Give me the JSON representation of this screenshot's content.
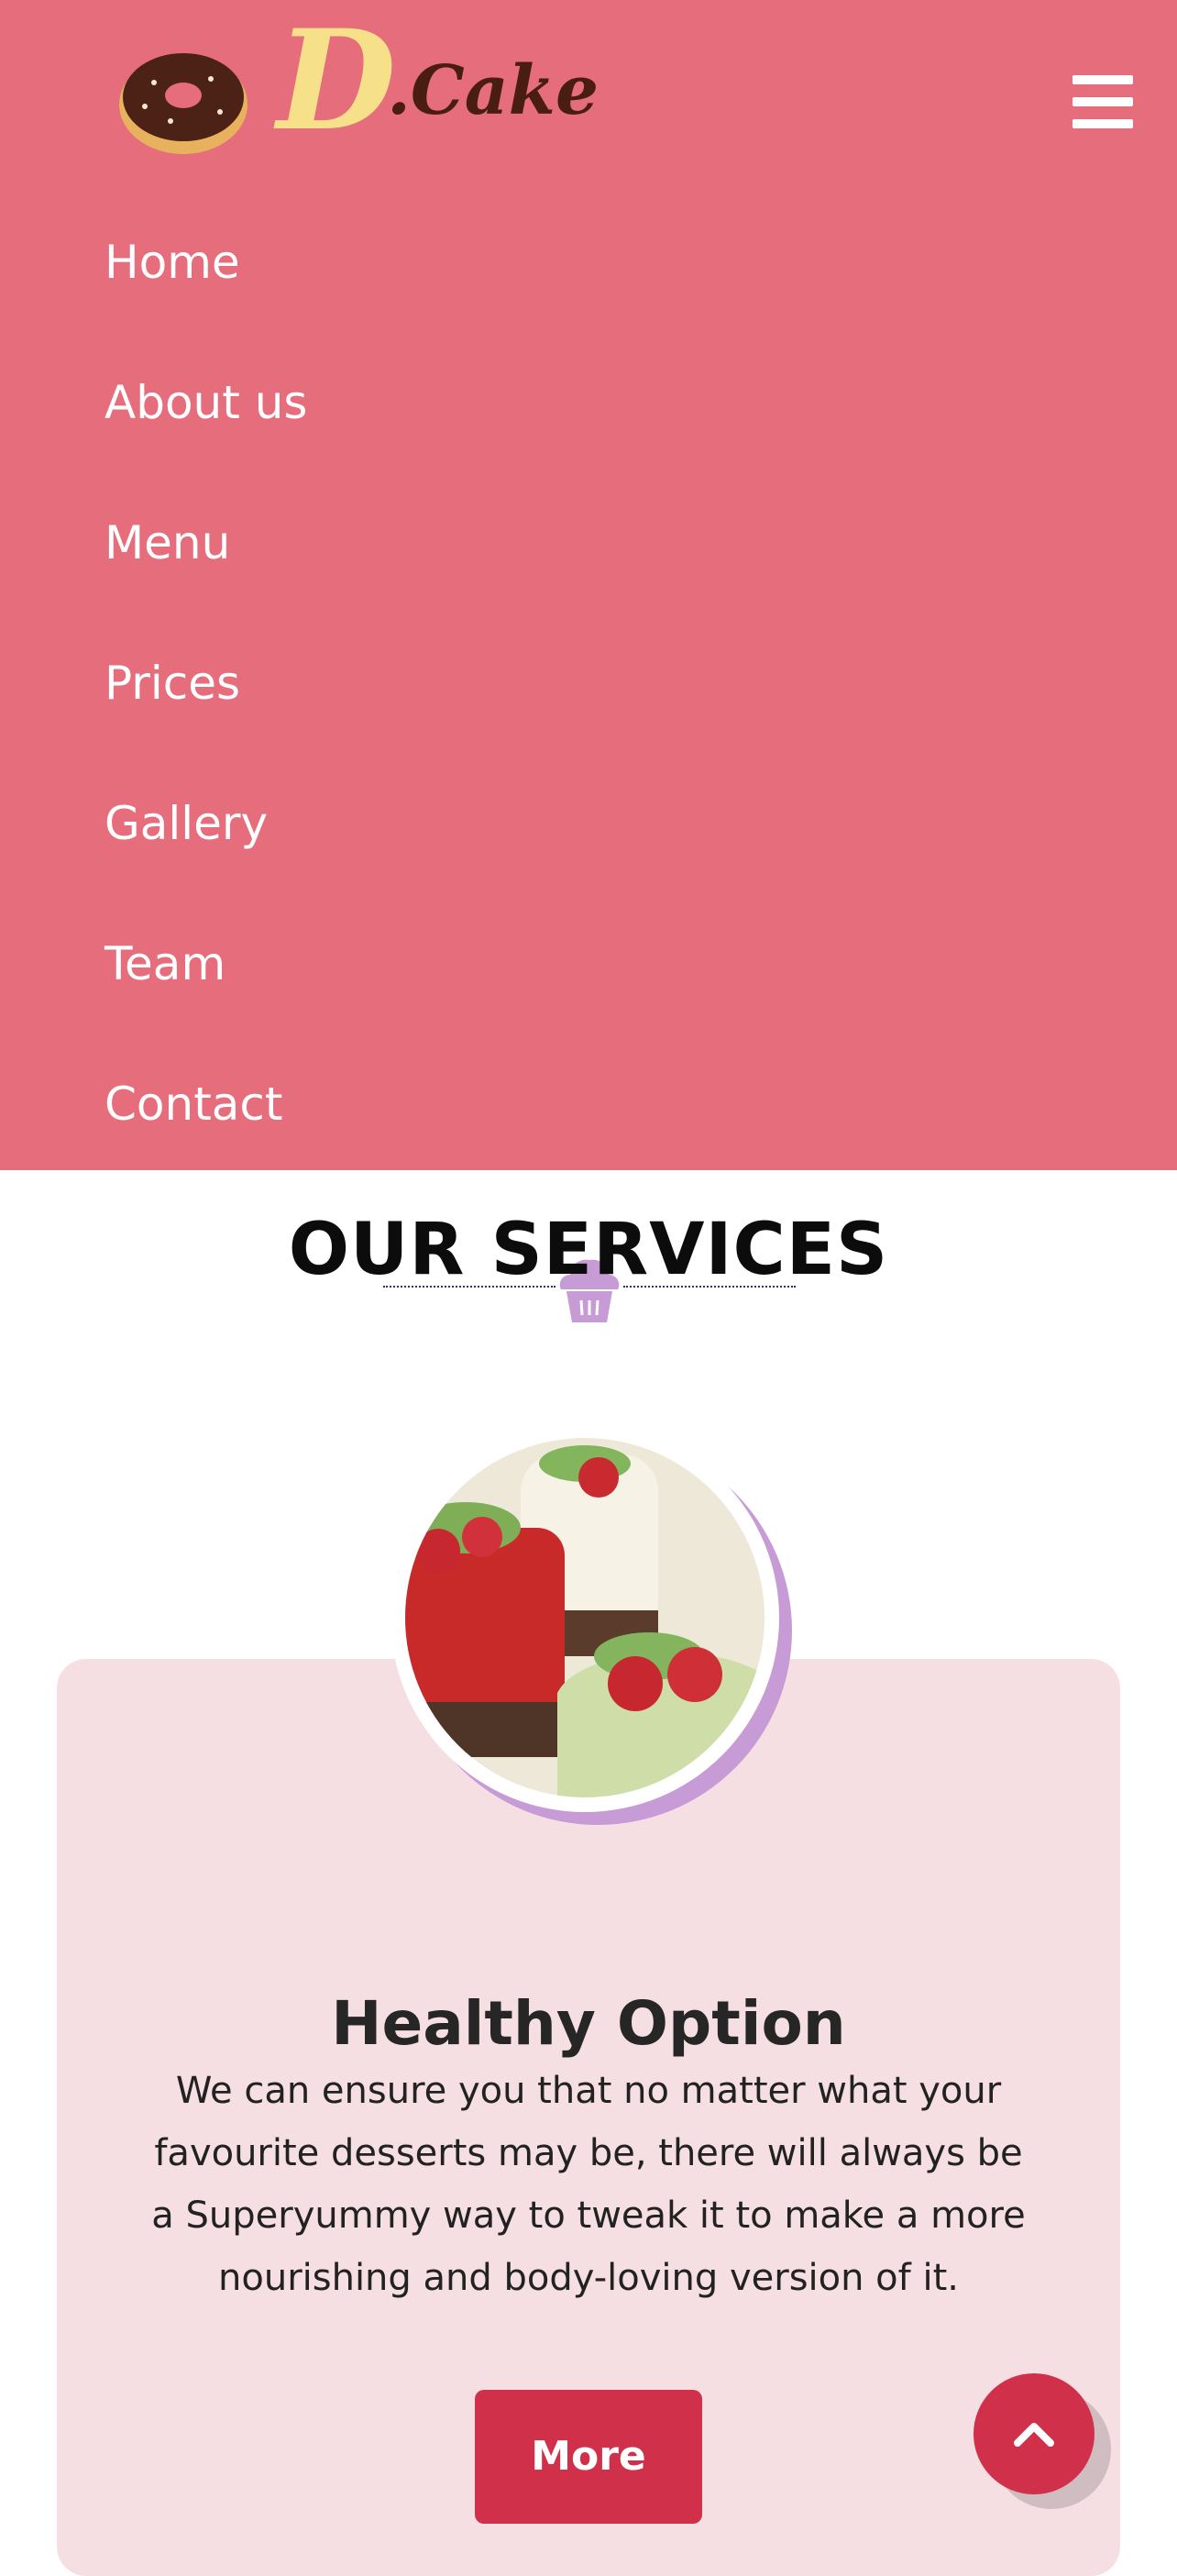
{
  "header": {
    "logo_alt": "D.Cake",
    "logo_letter": "D",
    "logo_word": ".Cake",
    "menu_icon": "hamburger-icon"
  },
  "nav": {
    "items": [
      {
        "label": "Home"
      },
      {
        "label": "About us"
      },
      {
        "label": "Menu"
      },
      {
        "label": "Prices"
      },
      {
        "label": "Gallery"
      },
      {
        "label": "Team"
      },
      {
        "label": "Contact"
      }
    ]
  },
  "services": {
    "title": "OUR SERVICES",
    "divider_icon": "cupcake-icon",
    "card": {
      "title": "Healthy Option",
      "text": "We can ensure you that no matter what your favourite desserts may be, there will always be a Superyummy way to tweak it to make a more nourishing and body-loving version of it.",
      "button": "More"
    }
  },
  "scroll_top_icon": "chevron-up-icon",
  "colors": {
    "nav_bg": "#e66d7c",
    "card_bg": "#f5dfe3",
    "accent": "#d0304a",
    "lavender": "#c79bd5"
  }
}
